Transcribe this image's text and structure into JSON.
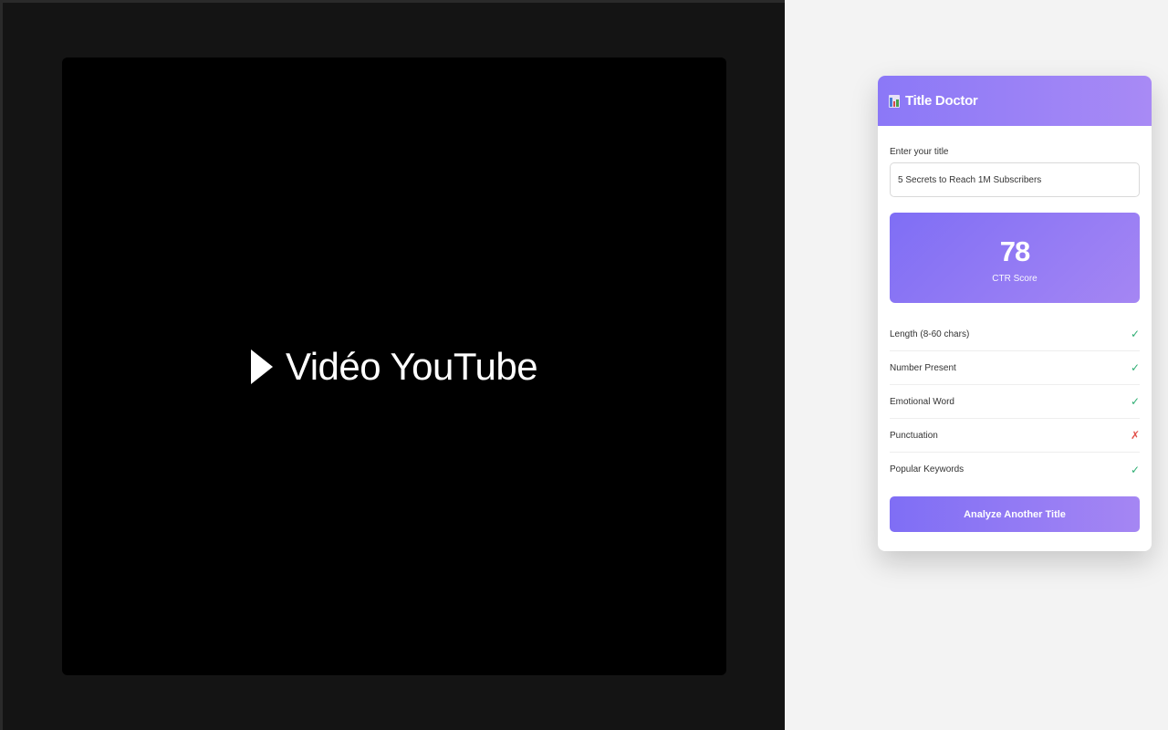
{
  "video": {
    "label": "Vidéo YouTube"
  },
  "panel": {
    "title": "Title Doctor",
    "input_label": "Enter your title",
    "input_value": "5 Secrets to Reach 1M Subscribers",
    "score": {
      "value": "78",
      "label": "CTR Score"
    },
    "checks": [
      {
        "label": "Length (8-60 chars)",
        "mark": "✓",
        "status": "pass"
      },
      {
        "label": "Number Present",
        "mark": "✓",
        "status": "pass"
      },
      {
        "label": "Emotional Word",
        "mark": "✓",
        "status": "pass"
      },
      {
        "label": "Punctuation",
        "mark": "✗",
        "status": "fail"
      },
      {
        "label": "Popular Keywords",
        "mark": "✓",
        "status": "pass"
      }
    ],
    "button_label": "Analyze Another Title"
  },
  "colors": {
    "accent_start": "#7f6ef5",
    "accent_end": "#a586f3",
    "pass": "#2fae73",
    "fail": "#e2504a"
  },
  "icons": {
    "header": "bar-chart-icon",
    "video": "play-icon"
  }
}
